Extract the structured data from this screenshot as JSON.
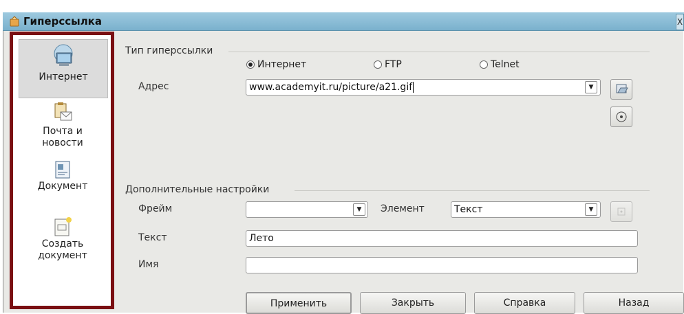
{
  "window": {
    "title": "Гиперссылка",
    "close_label": "X"
  },
  "sidebar": {
    "items": [
      {
        "label": "Интернет",
        "icon": "globe-icon",
        "selected": true
      },
      {
        "label": "Почта и новости",
        "icon": "mail-icon",
        "selected": false
      },
      {
        "label": "Документ",
        "icon": "document-icon",
        "selected": false
      },
      {
        "label": "Создать документ",
        "icon": "new-document-icon",
        "selected": false
      }
    ]
  },
  "hyperlink_type": {
    "label": "Тип гиперссылки",
    "options": [
      "Интернет",
      "FTP",
      "Telnet"
    ],
    "selected": "Интернет"
  },
  "address": {
    "label": "Адрес",
    "value": "www.academyit.ru/picture/a21.gif"
  },
  "advanced": {
    "label": "Дополнительные настройки",
    "frame_label": "Фрейм",
    "frame_value": "",
    "element_label": "Элемент",
    "element_value": "Текст",
    "text_label": "Текст",
    "text_value": "Лето",
    "name_label": "Имя",
    "name_value": ""
  },
  "buttons": {
    "apply": "Применить",
    "close": "Закрыть",
    "help": "Справка",
    "back": "Назад"
  },
  "colors": {
    "titlebar": "#8fbdd6",
    "highlight_border": "#7a0f12"
  }
}
